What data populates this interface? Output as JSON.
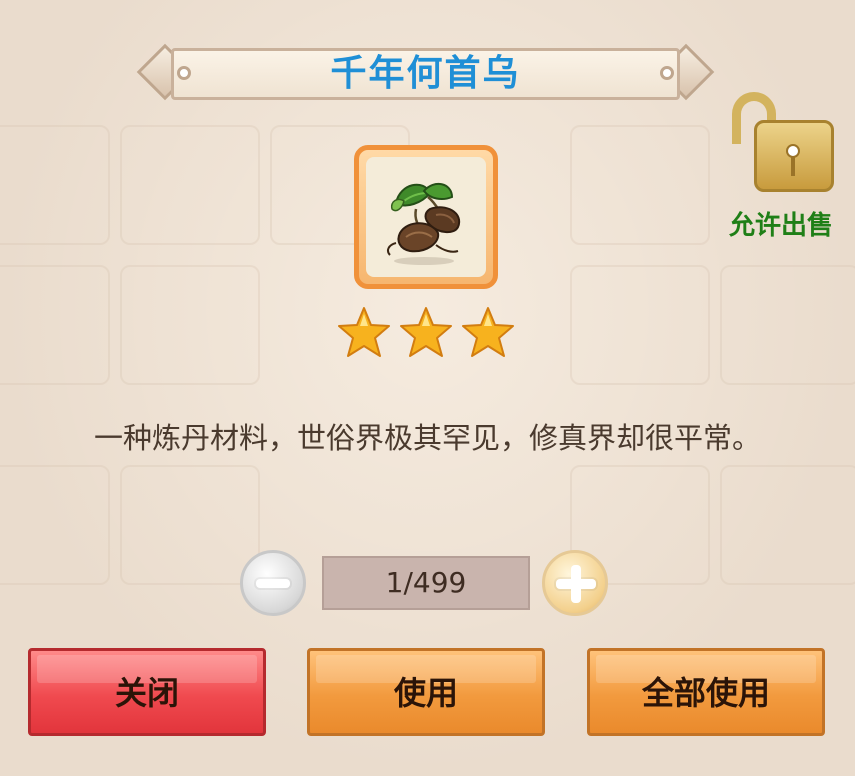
{
  "item": {
    "name": "千年何首乌",
    "stars": 3,
    "description": "一种炼丹材料，世俗界极其罕见，修真界却很平常。",
    "icon": "he-shou-wu-root-icon"
  },
  "lock": {
    "icon": "unlocked-padlock-icon",
    "label": "允许出售"
  },
  "quantity": {
    "value": "1/499",
    "minus_icon": "minus-icon",
    "plus_icon": "plus-icon"
  },
  "buttons": {
    "close": "关闭",
    "use": "使用",
    "use_all": "全部使用"
  },
  "colors": {
    "title": "#1f8fd6",
    "sell_label": "#1f7f17",
    "close_button": "#f04a4f",
    "use_button": "#f29a3e",
    "star": "#f7b21e"
  }
}
